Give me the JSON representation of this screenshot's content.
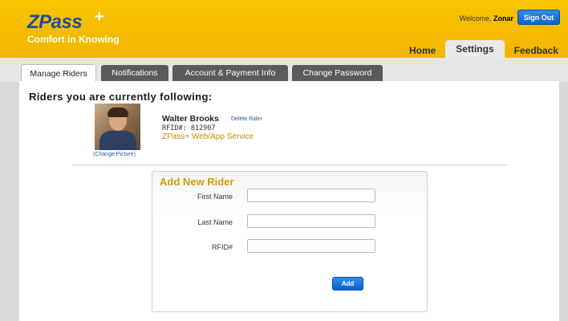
{
  "brand": {
    "name": "ZPass",
    "plus": "+",
    "tagline": "Comfort in Knowing",
    "color": "#1d4f9e",
    "header_color": "#f5bd00"
  },
  "header": {
    "welcome_prefix": "Welcome,",
    "welcome_user": "Zonar",
    "sign_out_label": "Sign Out"
  },
  "nav": {
    "items": [
      {
        "label": "Home"
      },
      {
        "label": "Settings",
        "active": true
      },
      {
        "label": "Feedback"
      }
    ]
  },
  "tabs": [
    {
      "label": "Manage Riders",
      "active": true
    },
    {
      "label": "Notifications"
    },
    {
      "label": "Account & Payment Info"
    },
    {
      "label": "Change Password"
    }
  ],
  "riders": {
    "section_title": "Riders you are currently following:",
    "list": [
      {
        "name": "Walter Brooks",
        "delete_label": "Delete Rider",
        "rfid_text": "RFID#: 812907",
        "service": "ZPass+ Web/App Service",
        "change_picture_label": "(Change Picture)"
      }
    ]
  },
  "add_rider": {
    "title": "Add New Rider",
    "fields": [
      {
        "label": "First Name",
        "value": "",
        "placeholder": ""
      },
      {
        "label": "Last Name",
        "value": "",
        "placeholder": ""
      },
      {
        "label": "RFID#",
        "value": "",
        "placeholder": ""
      }
    ],
    "submit_label": "Add"
  }
}
